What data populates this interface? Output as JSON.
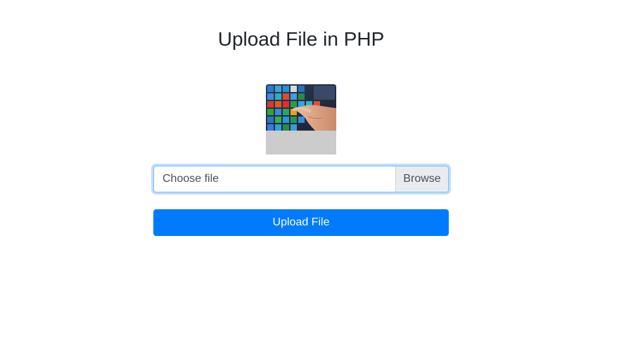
{
  "page": {
    "title": "Upload File in PHP"
  },
  "preview": {
    "image": "tablet-tiles-photo",
    "placeholder_color": "#cccccc"
  },
  "file_input": {
    "label": "Choose file",
    "browse_label": "Browse"
  },
  "upload_button": {
    "label": "Upload File",
    "color": "#007bff"
  }
}
